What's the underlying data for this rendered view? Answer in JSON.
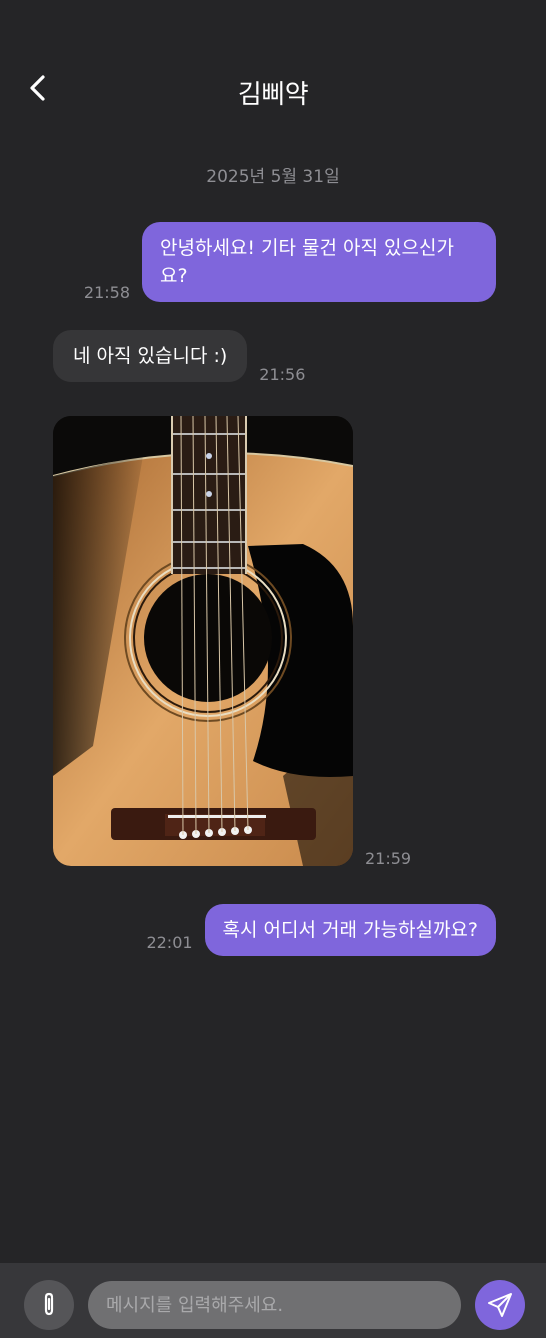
{
  "header": {
    "title": "김삐약",
    "back_icon": "chevron-left-icon"
  },
  "date_divider": "2025년 5월 31일",
  "messages": [
    {
      "direction": "outgoing",
      "text": "안녕하세요! 기타 물건 아직 있으신가요?",
      "time": "21:58"
    },
    {
      "direction": "incoming",
      "text": "네 아직 있습니다 :)",
      "time": "21:56"
    },
    {
      "direction": "incoming",
      "type": "image",
      "image_subject": "acoustic guitar",
      "time": "21:59"
    },
    {
      "direction": "outgoing",
      "text": "혹시 어디서 거래 가능하실까요?",
      "time": "22:01"
    }
  ],
  "composer": {
    "attach_icon": "paperclip-icon",
    "placeholder": "메시지를 입력해주세요.",
    "value": "",
    "send_icon": "send-icon"
  },
  "colors": {
    "background": "#252527",
    "accent": "#7f66dc",
    "incoming_bubble": "#363638",
    "input_bar": "#37373a"
  }
}
